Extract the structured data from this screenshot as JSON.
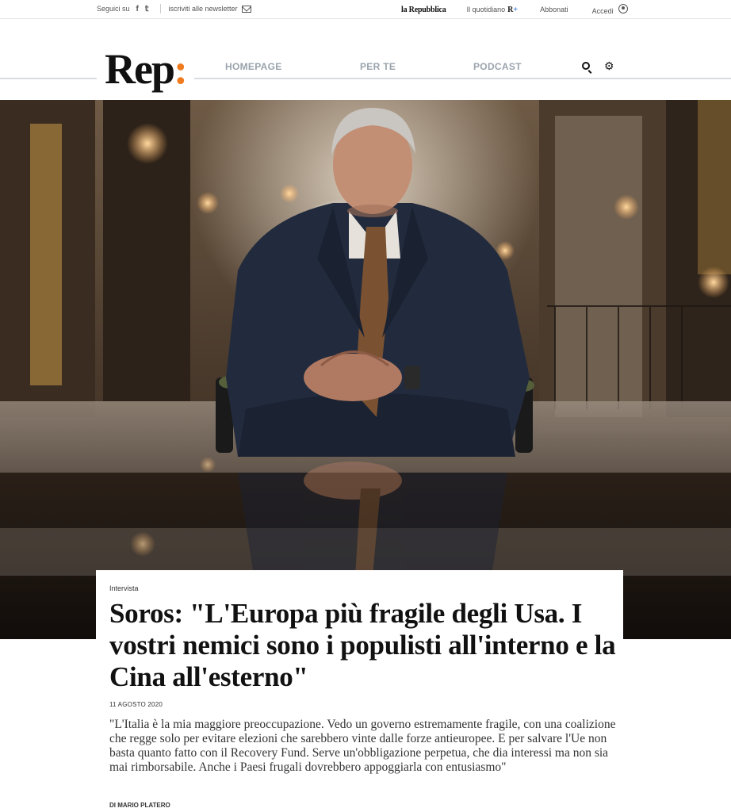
{
  "utility": {
    "follow_label": "Seguici su",
    "social": [
      {
        "icon": "facebook-icon",
        "glyph": "f"
      },
      {
        "icon": "twitter-icon",
        "glyph": "𝕥"
      }
    ],
    "newsletter_label": "iscriviti alle newsletter",
    "brand": "la Repubblica",
    "quotidiano_label": "Il quotidiano",
    "rplus_r": "R",
    "rplus_plus": "+",
    "subscribe_label": "Abbonati",
    "login_label": "Accedi"
  },
  "masthead": {
    "logo_text": "Rep",
    "logo_colon": ":",
    "nav": [
      "HOMEPAGE",
      "PER TE",
      "PODCAST"
    ],
    "accent_color": "#f07b1e"
  },
  "article": {
    "kicker": "Intervista",
    "headline": "Soros: \"L'Europa più fragile degli Usa. I vostri nemici sono i populisti all'interno e la Cina all'esterno\"",
    "date": "11 AGOSTO 2020",
    "summary": "\"L'Italia è la mia maggiore preoccupazione. Vedo un governo estremamente fragile, con una coalizione che regge solo per evitare elezioni che sarebbero vinte dalle forze antieuropee. E per salvare l'Ue non basta quanto fatto con il Recovery Fund. Serve un'obbligazione perpetua, che dia interessi ma non sia mai rimborsabile. Anche i Paesi frugali dovrebbero appoggiarla con entusiasmo\"",
    "byline": "DI MARIO PLATERO"
  }
}
